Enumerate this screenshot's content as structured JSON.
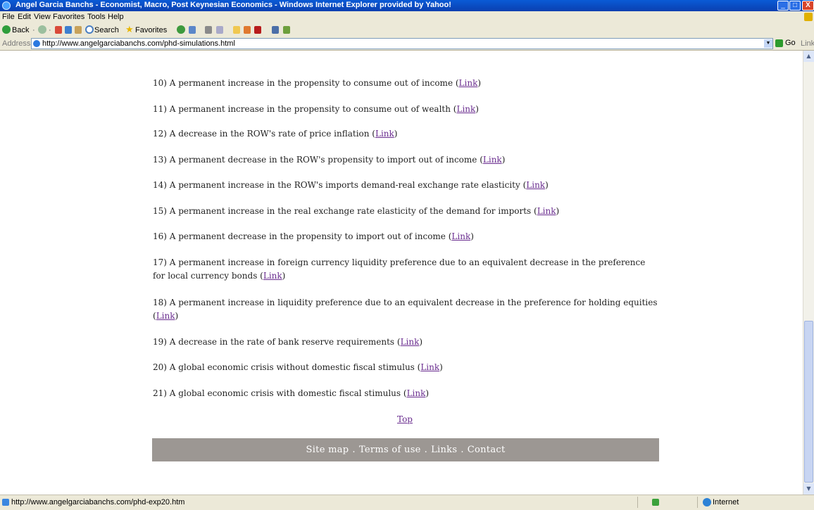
{
  "window": {
    "title": "Angel Garcia Banchs - Economist, Macro, Post Keynesian Economics - Windows Internet Explorer provided by Yahoo!",
    "controls": {
      "minimize": "_",
      "maximize": "□",
      "close": "X"
    }
  },
  "menu": [
    "File",
    "Edit",
    "View",
    "Favorites",
    "Tools",
    "Help"
  ],
  "toolbar": {
    "back": "Back",
    "search": "Search",
    "favorites": "Favorites"
  },
  "address": {
    "label": "Address",
    "url": "http://www.angelgarciabanchs.com/phd-simulations.html",
    "go": "Go",
    "links": "Links"
  },
  "items": [
    {
      "text": "10) A permanent increase in the propensity to consume out of income",
      "link": "Link"
    },
    {
      "text": "11) A permanent increase in the propensity to consume out of wealth",
      "link": "Link"
    },
    {
      "text": "12) A decrease in the ROW's rate of price inflation",
      "link": "Link"
    },
    {
      "text": "13) A permanent decrease in the ROW's propensity to import out of income",
      "link": "Link"
    },
    {
      "text": "14) A permanent increase in the ROW's imports demand-real exchange rate elasticity",
      "link": "Link"
    },
    {
      "text": "15) A permanent increase in the real exchange rate elasticity of the demand for imports",
      "link": "Link"
    },
    {
      "text": "16) A permanent decrease in the propensity to import out of income",
      "link": "Link"
    },
    {
      "text": "17) A permanent increase in foreign currency liquidity preference due to an equivalent decrease in the preference for local currency bonds",
      "link": "Link"
    },
    {
      "text": "18) A permanent increase in liquidity preference due to an equivalent decrease in the preference for holding equities",
      "link": "Link"
    },
    {
      "text": "19) A decrease in the rate of bank reserve requirements",
      "link": "Link"
    },
    {
      "text": "20) A global economic crisis without domestic fiscal stimulus",
      "link": "Link"
    },
    {
      "text": "21) A global economic crisis with domestic fiscal stimulus",
      "link": "Link"
    }
  ],
  "top_link": "Top",
  "footer": {
    "site_map": "Site map",
    "terms": "Terms of use",
    "links": "Links",
    "contact": "Contact",
    "separator": "."
  },
  "status": {
    "url": "http://www.angelgarciabanchs.com/phd-exp20.htm",
    "zone": "Internet"
  }
}
